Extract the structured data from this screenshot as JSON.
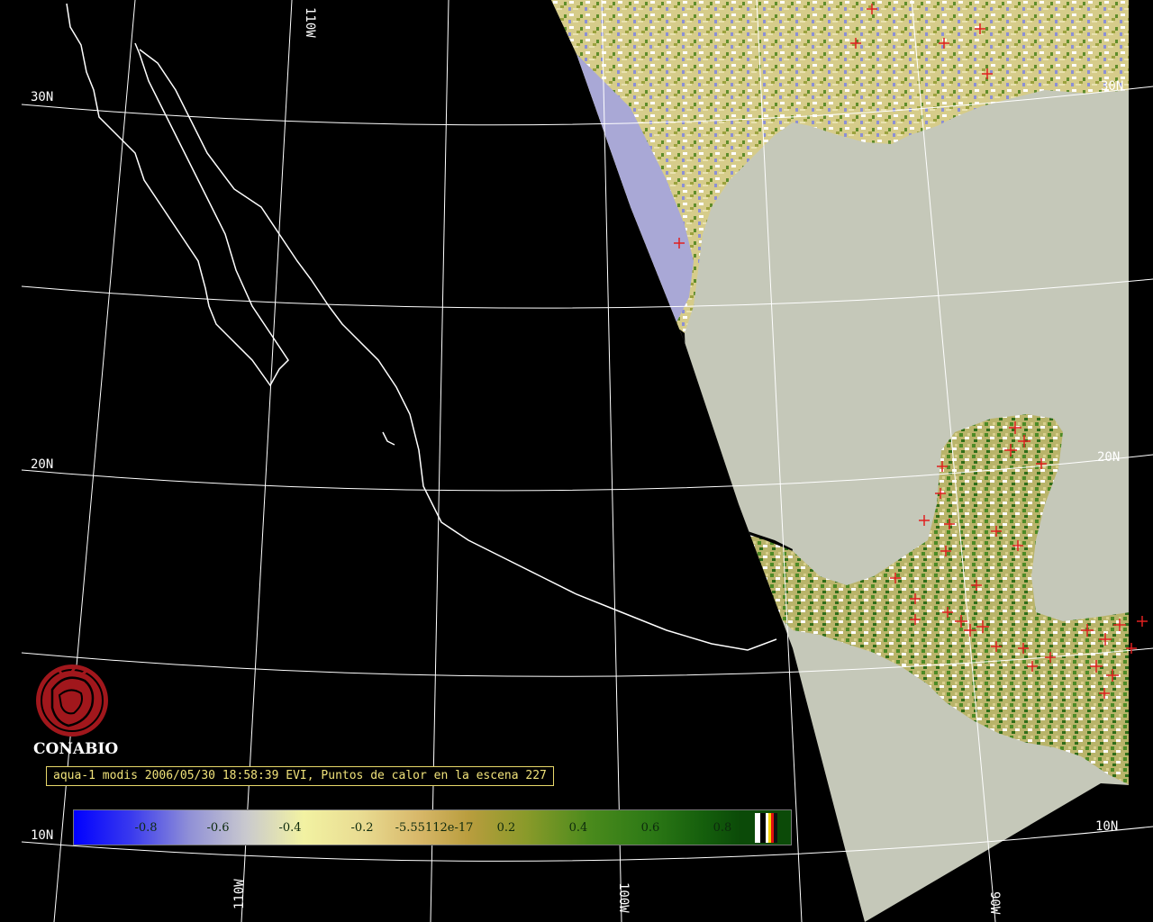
{
  "map": {
    "lat_labels": [
      "30N",
      "20N",
      "10N",
      "30N",
      "20N",
      "10N"
    ],
    "lon_labels": [
      "110W",
      "110W",
      "100W",
      "90W"
    ],
    "fire_marker_color": "#e02020",
    "land_colors": {
      "vegetation_low": "#d9cf8e",
      "vegetation_high": "#4d8a26",
      "cloud": "#ffffff",
      "water": "#c5c8b9",
      "negative_evi": "#7c82d6"
    }
  },
  "logo": {
    "name": "CONABIO",
    "color": "#a1171c"
  },
  "caption": "aqua-1 modis 2006/05/30 18:58:39 EVI, Puntos de calor en la escena 227",
  "colorbar": {
    "ticks": [
      "-0.8",
      "-0.6",
      "-0.4",
      "-0.2",
      "-5.55112e-17",
      "0.2",
      "0.4",
      "0.6",
      "0.8"
    ],
    "extra_swatches": [
      "#ffffff",
      "#000000",
      "#ffffff",
      "#f5d400",
      "#e01010",
      "#111111"
    ]
  }
}
